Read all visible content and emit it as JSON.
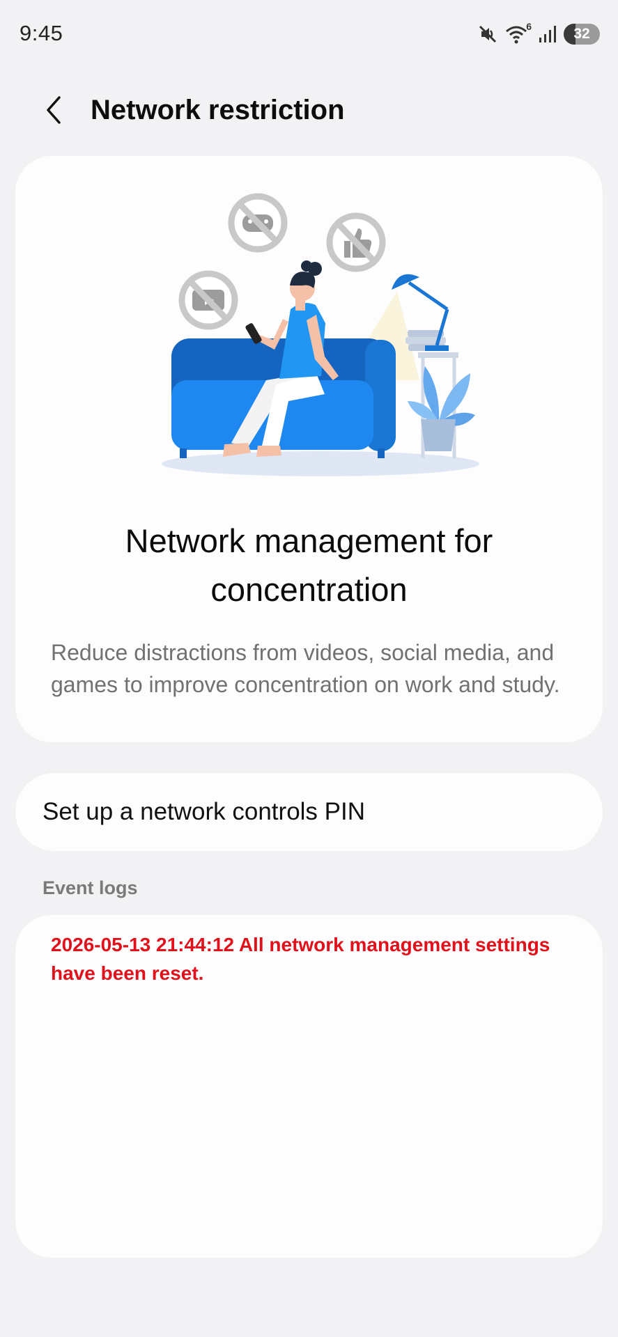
{
  "status_bar": {
    "time": "9:45",
    "wifi_badge": "6",
    "battery_level": "32",
    "icons": [
      "mute-icon",
      "wifi-icon",
      "signal-icon",
      "battery-icon"
    ]
  },
  "header": {
    "title": "Network restriction",
    "back_icon": "chevron-left-icon"
  },
  "hero": {
    "title": "Network management for concentration",
    "description": "Reduce distractions from videos, social media, and games to improve concentration on work and study."
  },
  "pin_setting": {
    "label": "Set up a network controls PIN"
  },
  "event_logs": {
    "header": "Event logs",
    "entries": [
      {
        "text": "2026-05-13 21:44:12 All network management settings have been reset.",
        "color": "#e0111a"
      }
    ]
  },
  "colors": {
    "background": "#f2f2f4",
    "card": "#fdfdfe",
    "accent_blue": "#1e88f0",
    "log_error": "#e0111a"
  }
}
